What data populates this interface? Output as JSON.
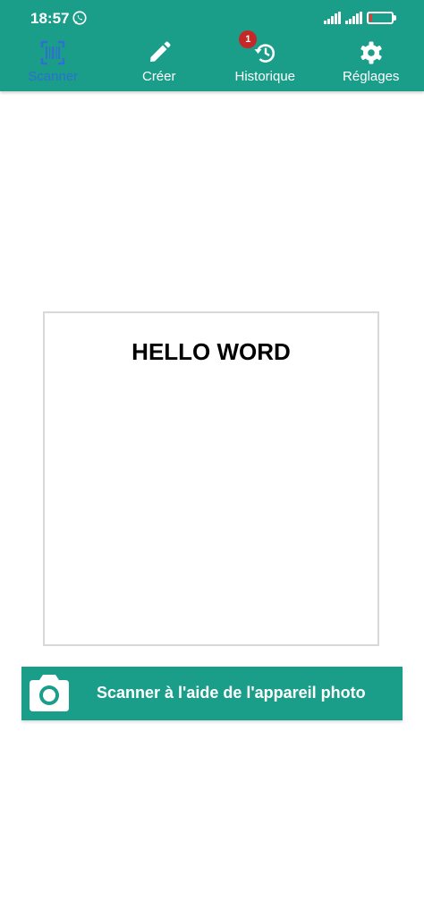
{
  "status_bar": {
    "time": "18:57",
    "battery_level": "14",
    "battery_fraction": 0.14,
    "battery_color": "#e53935"
  },
  "tabs": [
    {
      "label": "Scanner",
      "icon": "barcode-scanner-icon",
      "active": true
    },
    {
      "label": "Créer",
      "icon": "pencil-icon",
      "active": false
    },
    {
      "label": "Historique",
      "icon": "history-icon",
      "active": false,
      "badge": "1"
    },
    {
      "label": "Réglages",
      "icon": "gear-icon",
      "active": false
    }
  ],
  "result": {
    "text": "HELLO WORD"
  },
  "scan_button": {
    "label": "Scanner à l'aide de l'appareil photo",
    "icon": "camera-icon"
  },
  "colors": {
    "primary": "#1a9e8a",
    "active_tab": "#2e6fd1",
    "badge": "#c62828"
  }
}
